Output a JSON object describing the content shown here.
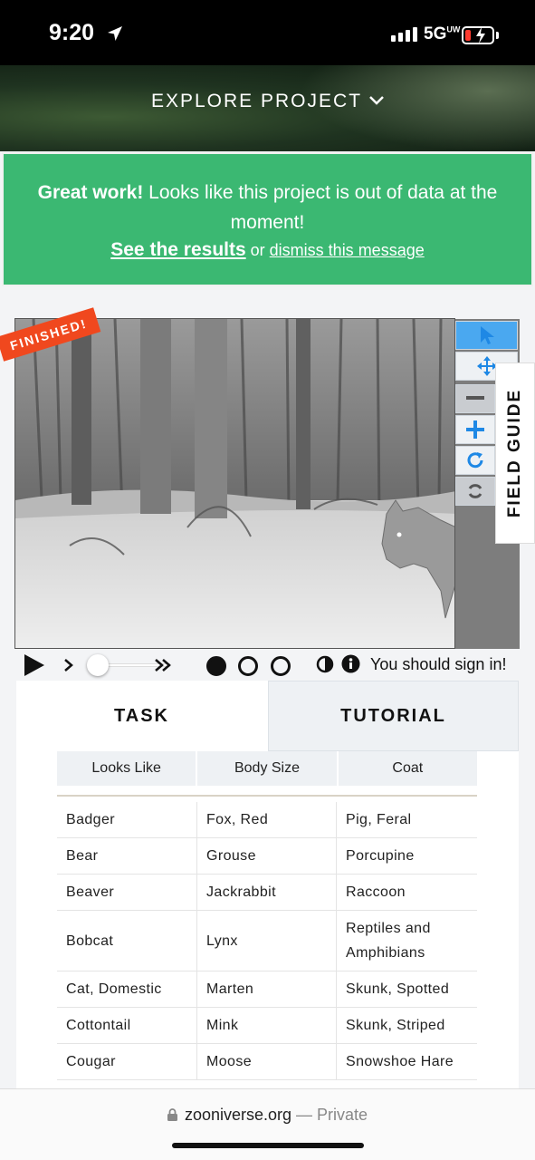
{
  "status_bar": {
    "time": "9:20",
    "network": "5G",
    "network_sup": "UW"
  },
  "hero": {
    "explore_label": "EXPLORE PROJECT"
  },
  "banner": {
    "strong": "Great work!",
    "message": " Looks like this project is out of data at the moment!",
    "see_results": "See the results",
    "or": " or ",
    "dismiss": "dismiss this message",
    "bg_color": "#3bb872"
  },
  "subject": {
    "badge": "FINISHED!",
    "badge_color": "#f0481e"
  },
  "field_guide": {
    "label": "FIELD GUIDE"
  },
  "controls": {
    "sign_in_text": "You should sign in!"
  },
  "tabs": {
    "task": "TASK",
    "tutorial": "TUTORIAL"
  },
  "filters": {
    "looks_like": "Looks Like",
    "body_size": "Body Size",
    "coat": "Coat"
  },
  "species": [
    [
      "Badger",
      "Fox, Red",
      "Pig, Feral"
    ],
    [
      "Bear",
      "Grouse",
      "Porcupine"
    ],
    [
      "Beaver",
      "Jackrabbit",
      "Raccoon"
    ],
    [
      "Bobcat",
      "Lynx",
      "Reptiles and Amphibians"
    ],
    [
      "Cat, Domestic",
      "Marten",
      "Skunk, Spotted"
    ],
    [
      "Cottontail",
      "Mink",
      "Skunk, Striped"
    ],
    [
      "Cougar",
      "Moose",
      "Snowshoe Hare"
    ]
  ],
  "browser": {
    "domain": "zooniverse.org",
    "separator": " — ",
    "mode": "Private"
  },
  "accent_color": "#4aa8f0"
}
